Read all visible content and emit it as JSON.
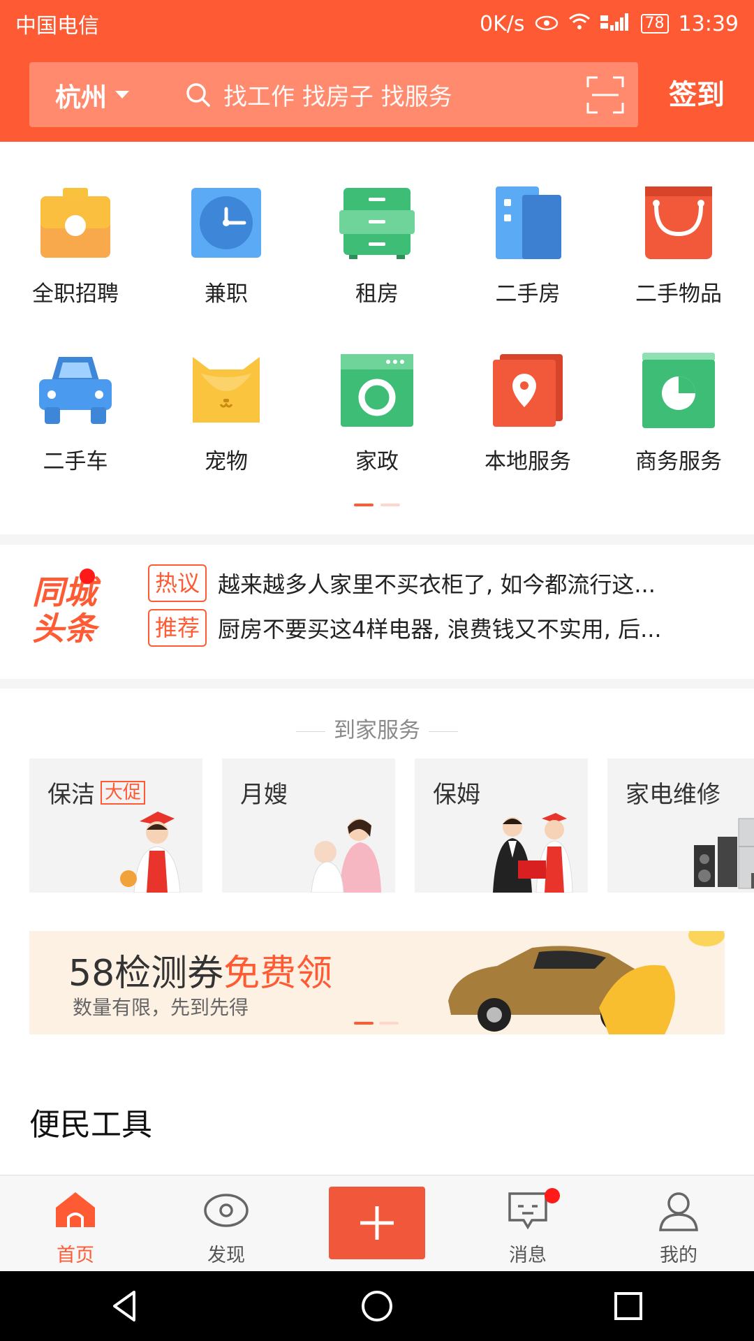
{
  "status_bar": {
    "carrier": "中国电信",
    "speed": "0K/s",
    "battery": "78",
    "time": "13:39"
  },
  "header": {
    "city": "杭州",
    "search_placeholder": "找工作 找房子 找服务",
    "signin_label": "签到"
  },
  "categories": [
    {
      "label": "全职招聘",
      "icon": "briefcase-icon",
      "color": "#f7a94b"
    },
    {
      "label": "兼职",
      "icon": "clock-icon",
      "color": "#4a9bf0"
    },
    {
      "label": "租房",
      "icon": "cabinet-icon",
      "color": "#3ebd77"
    },
    {
      "label": "二手房",
      "icon": "building-icon",
      "color": "#4a9bf0"
    },
    {
      "label": "二手物品",
      "icon": "shopping-bag-icon",
      "color": "#f2583a"
    },
    {
      "label": "二手车",
      "icon": "car-icon",
      "color": "#4a9bf0"
    },
    {
      "label": "宠物",
      "icon": "cat-icon",
      "color": "#fbc43e"
    },
    {
      "label": "家政",
      "icon": "washing-machine-icon",
      "color": "#3ebd77"
    },
    {
      "label": "本地服务",
      "icon": "location-pin-icon",
      "color": "#f2583a"
    },
    {
      "label": "商务服务",
      "icon": "pie-chart-icon",
      "color": "#3ebd77"
    }
  ],
  "headline": {
    "logo_line1": "同城",
    "logo_line2": "头条",
    "items": [
      {
        "tag": "热议",
        "text": "越来越多人家里不买衣柜了, 如今都流行这..."
      },
      {
        "tag": "推荐",
        "text": "厨房不要买这4样电器, 浪费钱又不实用, 后..."
      }
    ]
  },
  "home_services": {
    "title": "到家服务",
    "cards": [
      {
        "label": "保洁",
        "promo": "大促"
      },
      {
        "label": "月嫂"
      },
      {
        "label": "保姆"
      },
      {
        "label": "家电维修"
      }
    ]
  },
  "banner": {
    "title_main": "58检测券",
    "title_highlight": "免费领",
    "subtitle": "数量有限，先到先得"
  },
  "tools": {
    "title": "便民工具"
  },
  "tabbar": {
    "tabs": [
      {
        "label": "首页",
        "icon": "home-icon"
      },
      {
        "label": "发现",
        "icon": "eye-icon"
      },
      {
        "label": "",
        "icon": "plus-icon"
      },
      {
        "label": "消息",
        "icon": "message-icon"
      },
      {
        "label": "我的",
        "icon": "user-icon"
      }
    ]
  },
  "colors": {
    "brand": "#fe5a33",
    "badge": "#ff1a1a"
  }
}
